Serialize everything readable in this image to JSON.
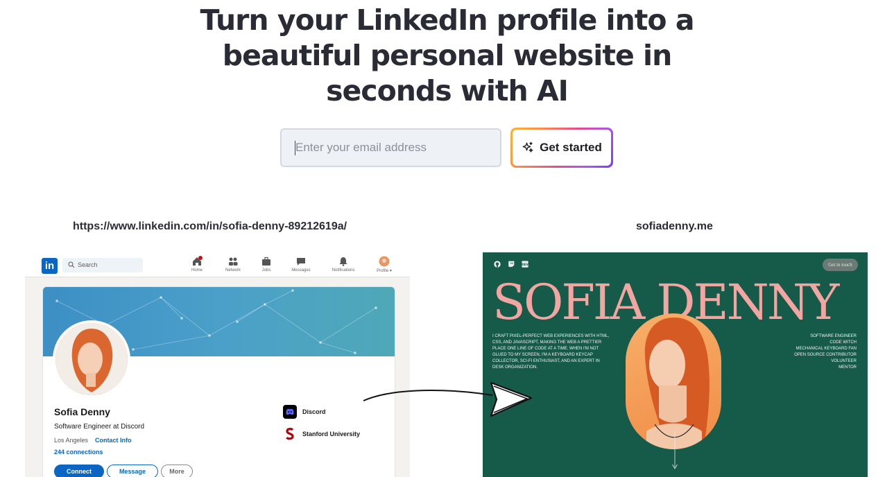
{
  "hero": {
    "title_line1": "Turn your LinkedIn profile into a",
    "title_line2": "beautiful personal website in",
    "title_line3": "seconds with AI"
  },
  "form": {
    "email_placeholder": "Enter your email address",
    "cta_label": "Get started",
    "cta_icon": "sparkles-icon"
  },
  "source": {
    "url": "https://www.linkedin.com/in/sofia-denny-89212619a/"
  },
  "destination": {
    "url": "sofiadenny.me"
  },
  "linkedin": {
    "logo": "in",
    "search_placeholder": "Search",
    "nav": [
      {
        "label": "Home",
        "icon": "home-icon"
      },
      {
        "label": "Network",
        "icon": "network-icon"
      },
      {
        "label": "Jobs",
        "icon": "briefcase-icon"
      },
      {
        "label": "Messages",
        "icon": "message-icon"
      },
      {
        "label": "Notifications",
        "icon": "bell-icon"
      },
      {
        "label": "Profile ▾",
        "icon": "profile-avatar"
      }
    ],
    "name": "Sofia Denny",
    "headline": "Software Engineer at Discord",
    "location": "Los Angeles",
    "contact_info": "Contact Info",
    "connections": "244 connections",
    "buttons": {
      "connect": "Connect",
      "message": "Message",
      "more": "More"
    },
    "orgs": [
      {
        "name": "Discord",
        "color": "#000000"
      },
      {
        "name": "Stanford University",
        "color": "#b1040e"
      }
    ],
    "accent": "#0a66c2"
  },
  "site": {
    "name": "SOFIA DENNY",
    "get_in_touch": "Get in touch",
    "intro": "I craft pixel-perfect web experiences with HTML, CSS, and JavaScript, making the web a prettier place one line of code at a time. When I'm not glued to my screen, I'm a keyboard keycap collector, sci-fi enthusiast, and an expert in desk organization.",
    "tags": [
      "Software Engineer",
      "Code Witch",
      "Mechanical Keyboard Fan",
      "Open Source Contributor",
      "Volunteer",
      "Mentor"
    ],
    "background": "#165a4a",
    "name_color": "#f1a6a2",
    "icons": [
      "github-icon",
      "twitch-icon",
      "dev-icon"
    ]
  }
}
